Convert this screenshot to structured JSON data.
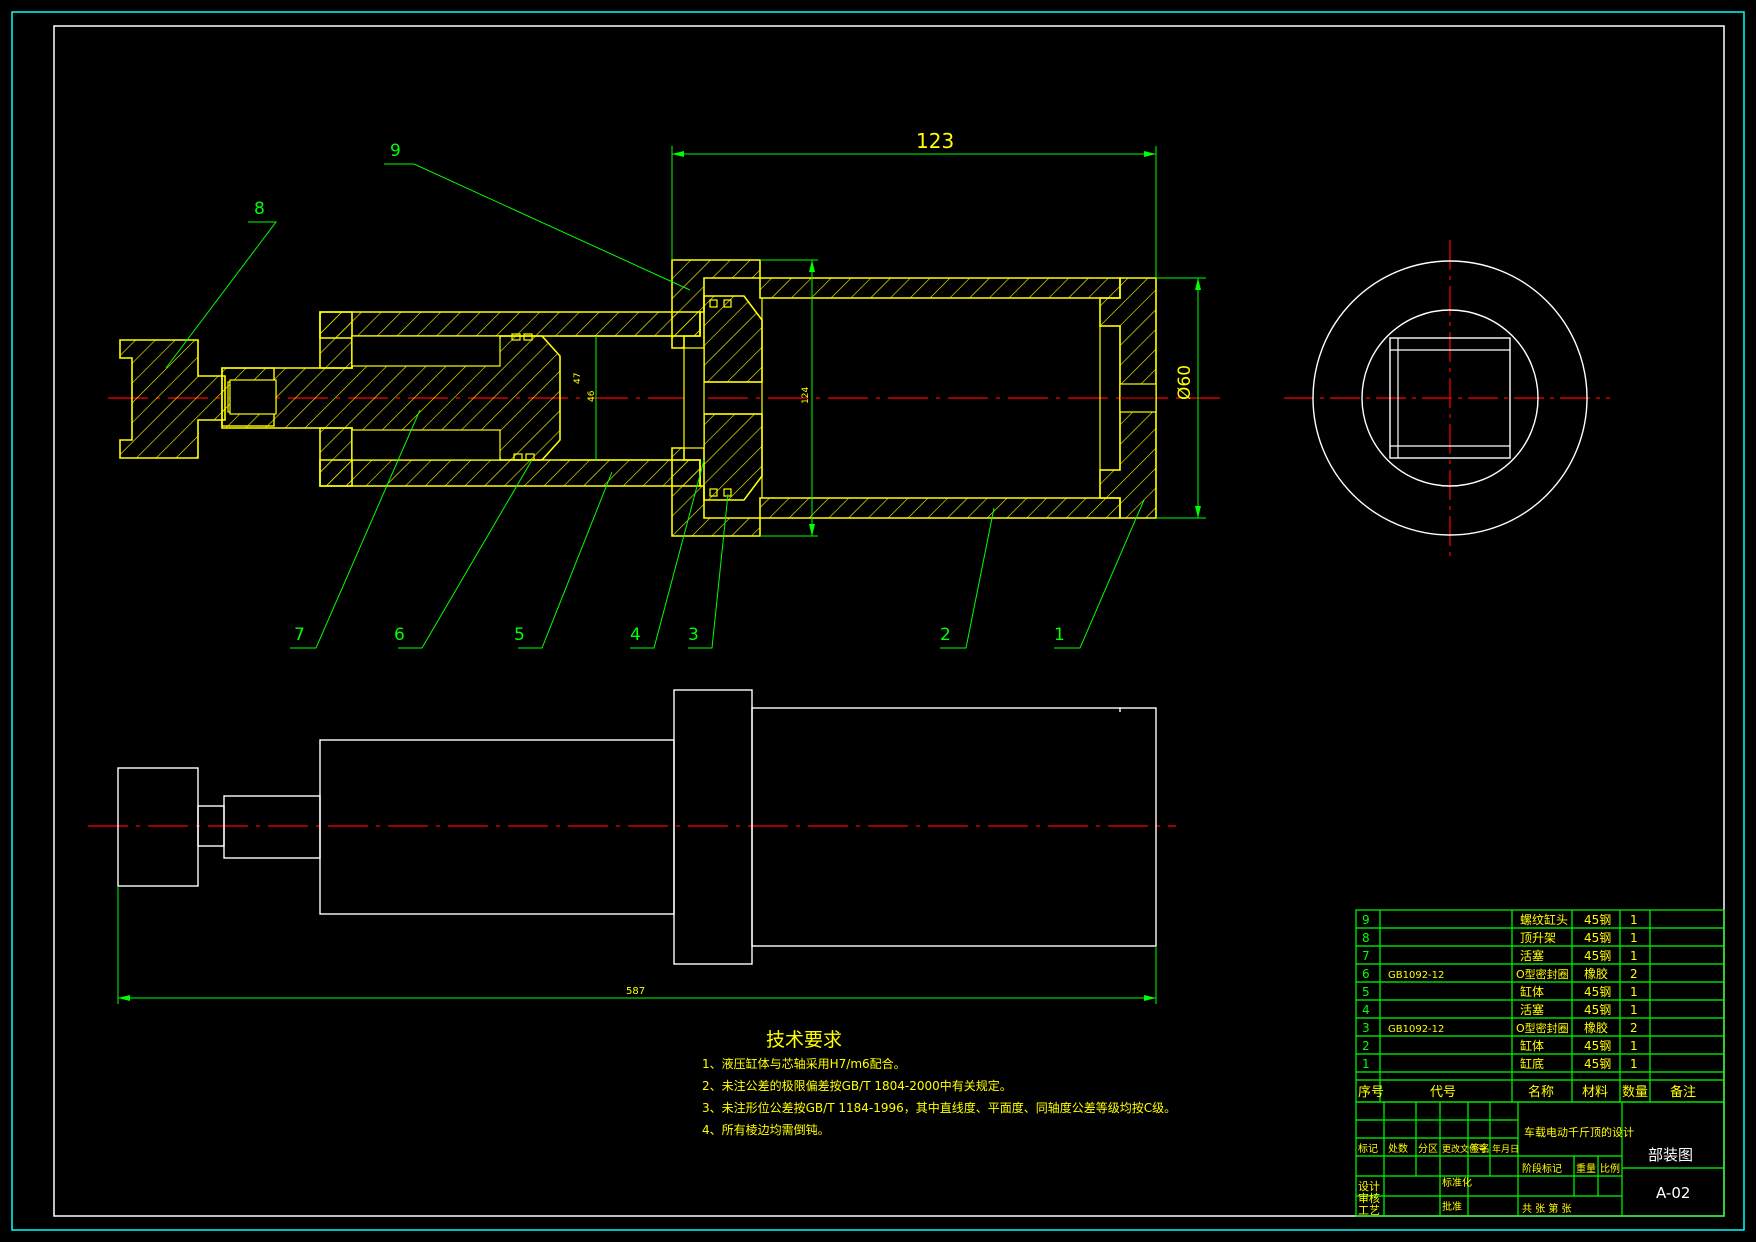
{
  "drawing": {
    "dimensions": {
      "overall_length_top": "123",
      "diameter": "Ø60",
      "bore_small": "47",
      "bore_small_2": "46",
      "bore_large": "124",
      "overall_length_bottom": "587"
    },
    "balloons": [
      "1",
      "2",
      "3",
      "4",
      "5",
      "6",
      "7",
      "8",
      "9"
    ],
    "colors": {
      "background": "#000000",
      "outline": "#ffff00",
      "leader": "#00ff00",
      "centerline": "#ff0000",
      "border": "#ffffff",
      "frame": "#00ffff"
    }
  },
  "notes": {
    "title": "技术要求",
    "items": [
      "1、液压缸体与芯轴采用H7/m6配合。",
      "2、未注公差的极限偏差按GB/T 1804-2000中有关规定。",
      "3、未注形位公差按GB/T 1184-1996，其中直线度、平面度、同轴度公差等级均按C级。",
      "4、所有棱边均需倒钝。"
    ]
  },
  "bom": {
    "rows": [
      {
        "no": "9",
        "code": "",
        "name": "螺纹缸头",
        "material": "45钢",
        "qty": "1",
        "remark": ""
      },
      {
        "no": "8",
        "code": "",
        "name": "顶升架",
        "material": "45钢",
        "qty": "1",
        "remark": ""
      },
      {
        "no": "7",
        "code": "",
        "name": "活塞",
        "material": "45钢",
        "qty": "1",
        "remark": ""
      },
      {
        "no": "6",
        "code": "GB1092-12",
        "name": "O型密封圈",
        "material": "橡胶",
        "qty": "2",
        "remark": ""
      },
      {
        "no": "5",
        "code": "",
        "name": "缸体",
        "material": "45钢",
        "qty": "1",
        "remark": ""
      },
      {
        "no": "4",
        "code": "",
        "name": "活塞",
        "material": "45钢",
        "qty": "1",
        "remark": ""
      },
      {
        "no": "3",
        "code": "GB1092-12",
        "name": "O型密封圈",
        "material": "橡胶",
        "qty": "2",
        "remark": ""
      },
      {
        "no": "2",
        "code": "",
        "name": "缸体",
        "material": "45钢",
        "qty": "1",
        "remark": ""
      },
      {
        "no": "1",
        "code": "",
        "name": "缸底",
        "material": "45钢",
        "qty": "1",
        "remark": ""
      }
    ],
    "header": {
      "no": "序号",
      "code": "代号",
      "name": "名称",
      "material": "材料",
      "qty": "数量",
      "remark": "备注"
    }
  },
  "title_block": {
    "project": "车载电动千斤顶的设计",
    "drawing_name": "部装图",
    "drawing_no": "A-02",
    "rev_headers": [
      "标记",
      "处数",
      "分区",
      "更改文件号",
      "签名",
      "年月日"
    ],
    "roles": [
      "设计",
      "审核",
      "工艺"
    ],
    "roles2": [
      "标准化",
      "批准"
    ],
    "stage_labels": [
      "阶段标记",
      "重量",
      "比例"
    ],
    "sheet": "共 张 第 张"
  }
}
